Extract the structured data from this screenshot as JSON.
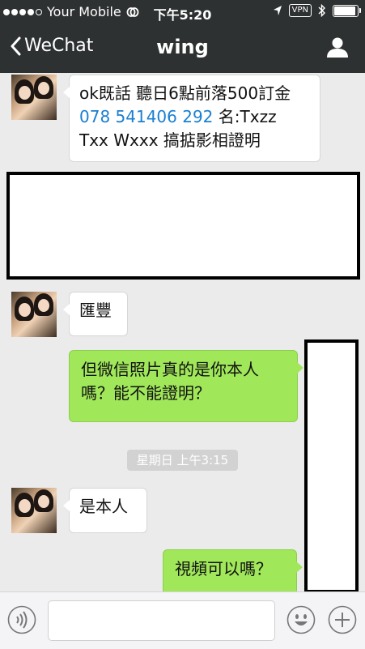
{
  "status_bar": {
    "carrier": "Your Mobile",
    "time": "下午5:20",
    "vpn_label": "VPN",
    "battery_level": 0.85
  },
  "nav": {
    "back_label": "WeChat",
    "title": "wing"
  },
  "messages": [
    {
      "side": "in",
      "text_before_phone": "ok既話 聽日6點前落500訂金 ",
      "phone": "078 541406 292",
      "text_after_phone": " 名:Txzz Txx Wxxx 搞掂影相證明"
    },
    {
      "side": "in",
      "redacted": true
    },
    {
      "side": "in",
      "text": "匯豐"
    },
    {
      "side": "out",
      "text": "但微信照片真的是你本人嗎？能不能證明？"
    },
    {
      "side": "in",
      "text": "是本人"
    },
    {
      "side": "out",
      "text": "視頻可以嗎？"
    }
  ],
  "timestamp_label": "星期日 上午3:15",
  "colors": {
    "bar_bg": "#2e3132",
    "chat_bg": "#ebebeb",
    "outgoing_bubble": "#a0e75a",
    "incoming_bubble": "#ffffff",
    "phone_link": "#1b7fd1"
  },
  "input_bar": {
    "voice_icon": "voice-icon",
    "emoji_icon": "emoji-icon",
    "add_icon": "add-icon"
  }
}
